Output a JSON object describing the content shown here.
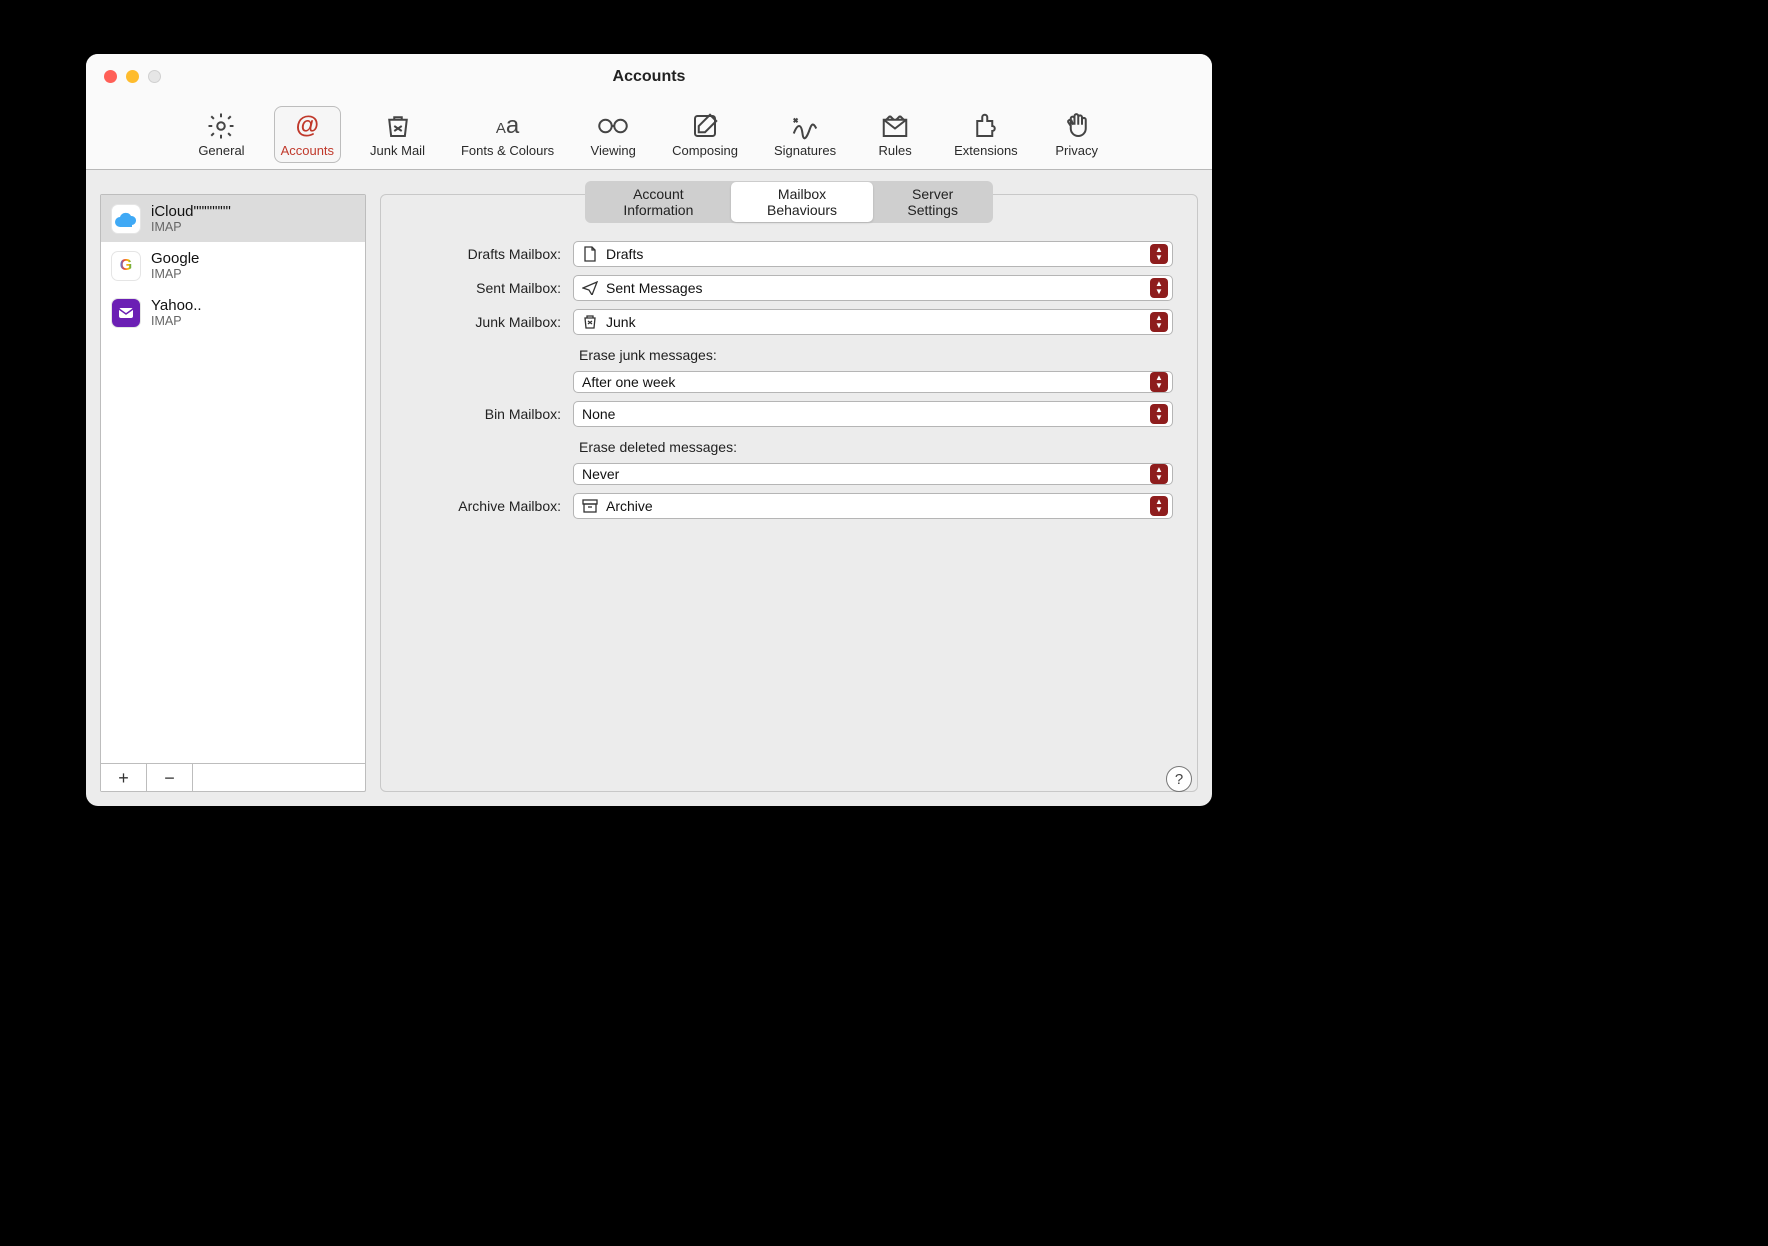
{
  "window": {
    "title": "Accounts"
  },
  "toolbar": {
    "selected_index": 1,
    "items": [
      {
        "id": "general",
        "label": "General"
      },
      {
        "id": "accounts",
        "label": "Accounts"
      },
      {
        "id": "junkmail",
        "label": "Junk Mail"
      },
      {
        "id": "fonts",
        "label": "Fonts & Colours"
      },
      {
        "id": "viewing",
        "label": "Viewing"
      },
      {
        "id": "composing",
        "label": "Composing"
      },
      {
        "id": "signatures",
        "label": "Signatures"
      },
      {
        "id": "rules",
        "label": "Rules"
      },
      {
        "id": "extensions",
        "label": "Extensions"
      },
      {
        "id": "privacy",
        "label": "Privacy"
      }
    ]
  },
  "sidebar": {
    "selected_index": 0,
    "accounts": [
      {
        "name": "iCloud\"\"\"\"\"\"\"",
        "subtitle": "IMAP",
        "provider": "icloud"
      },
      {
        "name": "Google",
        "subtitle": "IMAP",
        "provider": "google"
      },
      {
        "name": "Yahoo..",
        "subtitle": "IMAP",
        "provider": "yahoo"
      }
    ],
    "add_label": "+",
    "remove_label": "−"
  },
  "tabs": {
    "selected_index": 1,
    "items": [
      {
        "label": "Account Information"
      },
      {
        "label": "Mailbox Behaviours"
      },
      {
        "label": "Server Settings"
      }
    ]
  },
  "labels": {
    "drafts": "Drafts Mailbox:",
    "sent": "Sent Mailbox:",
    "junk": "Junk Mailbox:",
    "bin": "Bin Mailbox:",
    "archive": "Archive Mailbox:",
    "erase_junk": "Erase junk messages:",
    "erase_deleted": "Erase deleted messages:"
  },
  "values": {
    "drafts": "Drafts",
    "sent": "Sent Messages",
    "junk": "Junk",
    "erase_junk": "After one week",
    "bin": "None",
    "erase_deleted": "Never",
    "archive": "Archive"
  },
  "help": {
    "label": "?"
  },
  "colors": {
    "accent": "#c0392b",
    "stepper": "#8e1d1d"
  }
}
